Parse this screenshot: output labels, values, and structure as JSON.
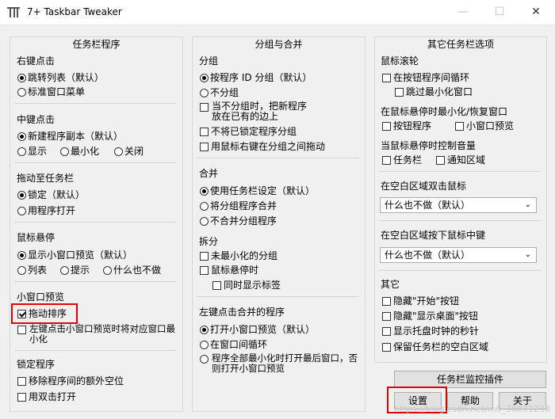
{
  "window": {
    "title": "7+ Taskbar Tweaker",
    "min": "—",
    "max": "☐",
    "close": "✕"
  },
  "col1": {
    "title": "任务栏程序",
    "right_click": {
      "label": "右键点击",
      "jump": "跳转列表（默认）",
      "std": "标准窗口菜单"
    },
    "middle_click": {
      "label": "中键点击",
      "new": "新建程序副本（默认）",
      "show": "显示",
      "minimize": "最小化",
      "close": "关闭"
    },
    "drag": {
      "label": "拖动至任务栏",
      "lock": "锁定（默认）",
      "open": "用程序打开"
    },
    "hover": {
      "label": "鼠标悬停",
      "thumb": "显示小窗口预览（默认）",
      "list": "列表",
      "tip": "提示",
      "nothing": "什么也不做"
    },
    "thumb": {
      "label": "小窗口预览",
      "drag_sort": "拖动排序",
      "lclick": "左键点击小窗口预览时将对应窗口最小化"
    },
    "pinned": {
      "label": "锁定程序",
      "remove_gap": "移除程序间的额外空位",
      "dbl_open": "用双击打开"
    }
  },
  "col2": {
    "title": "分组与合并",
    "group": {
      "label": "分组",
      "by_id": "按程序 ID 分组（默认）",
      "no": "不分组",
      "when_no": "当不分组时，把新程序放在已有的边上",
      "no_pinned": "不将已锁定程序分组",
      "rdrag": "用鼠标右键在分组之间拖动"
    },
    "combine": {
      "label": "合并",
      "use_setting": "使用任务栏设定（默认）",
      "combine_group": "将分组程序合并",
      "no_combine": "不合并分组程序"
    },
    "split": {
      "label": "拆分",
      "unmin": "未最小化的分组",
      "hover": "鼠标悬停时",
      "show_label": "同时显示标签"
    },
    "lclick": {
      "label": "左键点击合并的程序",
      "open_thumb": "打开小窗口预览（默认）",
      "cycle": "在窗口间循环",
      "restore": "程序全部最小化时打开最后窗口，否则打开小窗口预览"
    }
  },
  "col3": {
    "title": "其它任务栏选项",
    "wheel": {
      "label": "鼠标滚轮",
      "cycle_btn": "在按钮程序间循环",
      "skip_min": "跳过最小化窗口"
    },
    "hover_min": {
      "label": "在鼠标悬停时最小化/恢复窗口",
      "btn": "按钮程序",
      "thumb": "小窗口预览"
    },
    "volume": {
      "label": "当鼠标悬停时控制音量",
      "taskbar": "任务栏",
      "tray": "通知区域"
    },
    "dbl_empty": {
      "label": "在空白区域双击鼠标",
      "value": "什么也不做（默认）"
    },
    "mid_empty": {
      "label": "在空白区域按下鼠标中键",
      "value": "什么也不做（默认）"
    },
    "other": {
      "label": "其它",
      "hide_start": "隐藏\"开始\"按钮",
      "hide_desktop": "隐藏\"显示桌面\"按钮",
      "show_seconds": "显示托盘时钟的秒针",
      "keep_space": "保留任务栏的空白区域"
    }
  },
  "buttons": {
    "inspector": "任务栏监控插件",
    "settings": "设置",
    "help": "帮助",
    "about": "关于"
  },
  "watermark": "https://blog.csdn.net/m0_38831238"
}
